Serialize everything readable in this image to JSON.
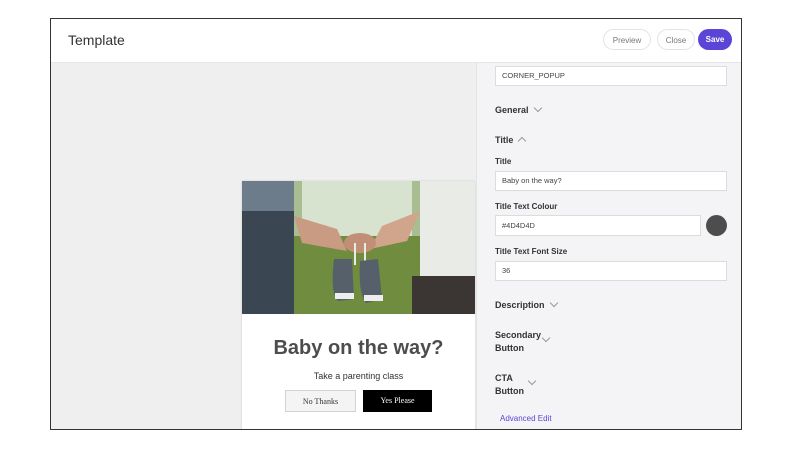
{
  "header": {
    "title": "Template",
    "preview_label": "Preview",
    "close_label": "Close",
    "save_label": "Save"
  },
  "colors": {
    "accent": "#5B45D6",
    "title_text": "#4D4D4D"
  },
  "popup": {
    "heading": "Baby on the way?",
    "subtext": "Take a parenting class",
    "no_button": "No Thanks",
    "yes_button": "Yes Please"
  },
  "panel": {
    "template_type": "CORNER_POPUP",
    "sections": {
      "general": "General",
      "title": "Title",
      "description": "Description",
      "secondary_button_line1": "Secondary",
      "secondary_button_line2": "Button",
      "cta_line1": "CTA",
      "cta_line2": "Button"
    },
    "fields": {
      "title_label": "Title",
      "title_value": "Baby on the way?",
      "colour_label": "Title Text Colour",
      "colour_value": "#4D4D4D",
      "font_size_label": "Title Text Font Size",
      "font_size_value": "36"
    },
    "advanced_edit": "Advanced Edit"
  }
}
